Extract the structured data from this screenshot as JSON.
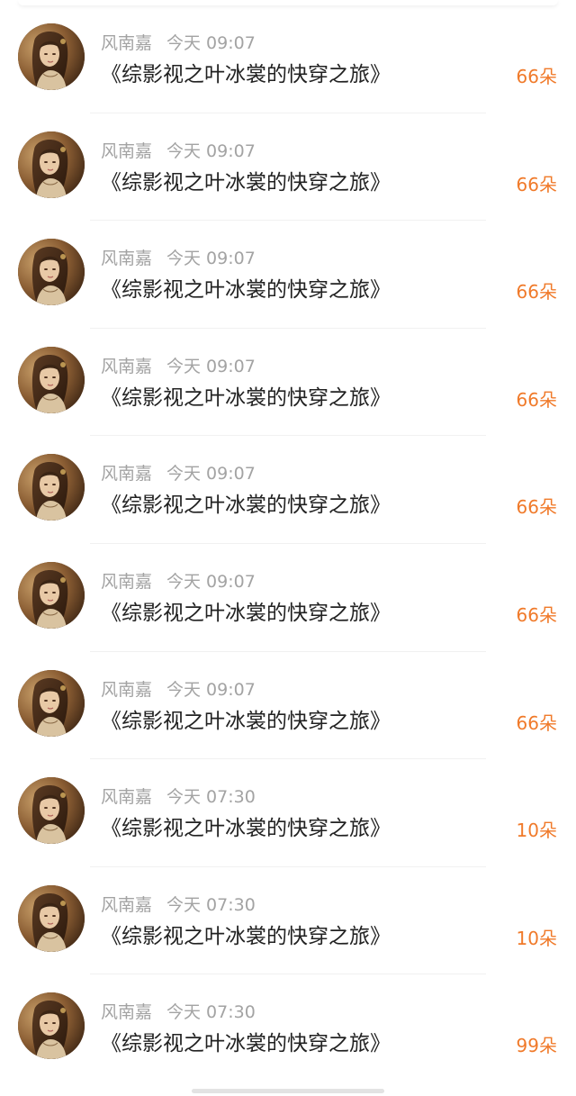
{
  "colors": {
    "background": "#ffffff",
    "name_text": "#a3a3a3",
    "title_text": "#222222",
    "amount_accent": "#f07a2a",
    "divider": "#f1f1f1"
  },
  "rows": [
    {
      "avatar_icon": "avatar-portrait",
      "name": "风南嘉",
      "time": "今天 09:07",
      "title": "《综影视之叶冰裳的快穿之旅》",
      "amount": "66朵"
    },
    {
      "avatar_icon": "avatar-portrait",
      "name": "风南嘉",
      "time": "今天 09:07",
      "title": "《综影视之叶冰裳的快穿之旅》",
      "amount": "66朵"
    },
    {
      "avatar_icon": "avatar-portrait",
      "name": "风南嘉",
      "time": "今天 09:07",
      "title": "《综影视之叶冰裳的快穿之旅》",
      "amount": "66朵"
    },
    {
      "avatar_icon": "avatar-portrait",
      "name": "风南嘉",
      "time": "今天 09:07",
      "title": "《综影视之叶冰裳的快穿之旅》",
      "amount": "66朵"
    },
    {
      "avatar_icon": "avatar-portrait",
      "name": "风南嘉",
      "time": "今天 09:07",
      "title": "《综影视之叶冰裳的快穿之旅》",
      "amount": "66朵"
    },
    {
      "avatar_icon": "avatar-portrait",
      "name": "风南嘉",
      "time": "今天 09:07",
      "title": "《综影视之叶冰裳的快穿之旅》",
      "amount": "66朵"
    },
    {
      "avatar_icon": "avatar-portrait",
      "name": "风南嘉",
      "time": "今天 09:07",
      "title": "《综影视之叶冰裳的快穿之旅》",
      "amount": "66朵"
    },
    {
      "avatar_icon": "avatar-portrait",
      "name": "风南嘉",
      "time": "今天 07:30",
      "title": "《综影视之叶冰裳的快穿之旅》",
      "amount": "10朵"
    },
    {
      "avatar_icon": "avatar-portrait",
      "name": "风南嘉",
      "time": "今天 07:30",
      "title": "《综影视之叶冰裳的快穿之旅》",
      "amount": "10朵"
    },
    {
      "avatar_icon": "avatar-portrait",
      "name": "风南嘉",
      "time": "今天 07:30",
      "title": "《综影视之叶冰裳的快穿之旅》",
      "amount": "99朵"
    }
  ]
}
